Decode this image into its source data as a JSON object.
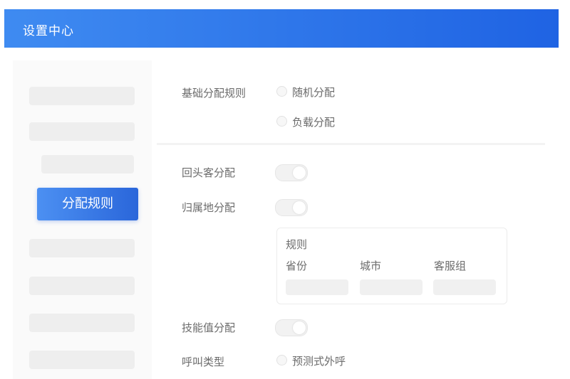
{
  "header": {
    "title": "设置中心"
  },
  "sidebar": {
    "active_label": "分配规则"
  },
  "basic_rule": {
    "label": "基础分配规则",
    "options": [
      "随机分配",
      "负载分配"
    ]
  },
  "returning_customer": {
    "label": "回头客分配"
  },
  "region": {
    "label": "归属地分配"
  },
  "rule_card": {
    "title": "规则",
    "columns": [
      "省份",
      "城市",
      "客服组"
    ]
  },
  "skill": {
    "label": "技能值分配"
  },
  "call_type": {
    "label": "呼叫类型",
    "option": "预测式外呼"
  },
  "colors": {
    "accent": "#2a66da",
    "header_start": "#3f8bf1",
    "header_end": "#1f63e3"
  }
}
